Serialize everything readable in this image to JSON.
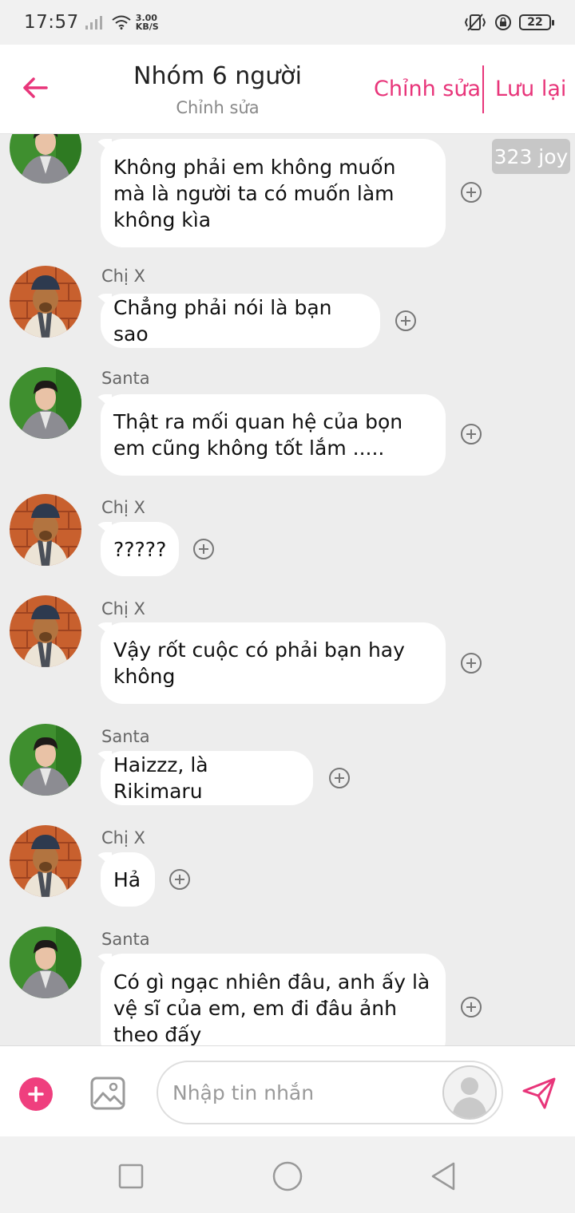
{
  "status_bar": {
    "time": "17:57",
    "net_speed_value": "3.00",
    "net_speed_unit": "KB/S",
    "battery": "22"
  },
  "header": {
    "title": "Nhóm 6 người",
    "subtitle": "Chỉnh sửa",
    "edit_label": "Chỉnh sửa",
    "save_label": "Lưu lại"
  },
  "badge": {
    "joy": "323 joy"
  },
  "messages": [
    {
      "sender": "",
      "avatar": "santa-avatar",
      "text": "Không phải em không muốn mà là người ta có muốn làm không kìa"
    },
    {
      "sender": "Chị X",
      "avatar": "dog-avatar",
      "text": "Chẳng phải nói là bạn sao"
    },
    {
      "sender": "Santa",
      "avatar": "santa-avatar",
      "text": "Thật ra mối quan hệ của bọn em cũng không tốt lắm ....."
    },
    {
      "sender": "Chị X",
      "avatar": "dog-avatar",
      "text": "?????"
    },
    {
      "sender": "Chị X",
      "avatar": "dog-avatar",
      "text": "Vậy rốt cuộc có phải bạn hay không"
    },
    {
      "sender": "Santa",
      "avatar": "santa-avatar",
      "text": "Haizzz, là Rikimaru"
    },
    {
      "sender": "Chị X",
      "avatar": "dog-avatar",
      "text": "Hả"
    },
    {
      "sender": "Santa",
      "avatar": "santa-avatar",
      "text": "Có gì ngạc nhiên đâu, anh ấy là vệ sĩ của em, em đi đâu ảnh theo đấy"
    }
  ],
  "input": {
    "placeholder": "Nhập tin nhắn",
    "value": ""
  },
  "colors": {
    "accent": "#e8357a",
    "chat_background": "#ededed",
    "bubble": "#ffffff"
  },
  "icons": {
    "back": "arrow-left-icon",
    "add": "plus-icon",
    "image": "image-icon",
    "send": "send-icon",
    "react": "plus-circle-icon"
  }
}
